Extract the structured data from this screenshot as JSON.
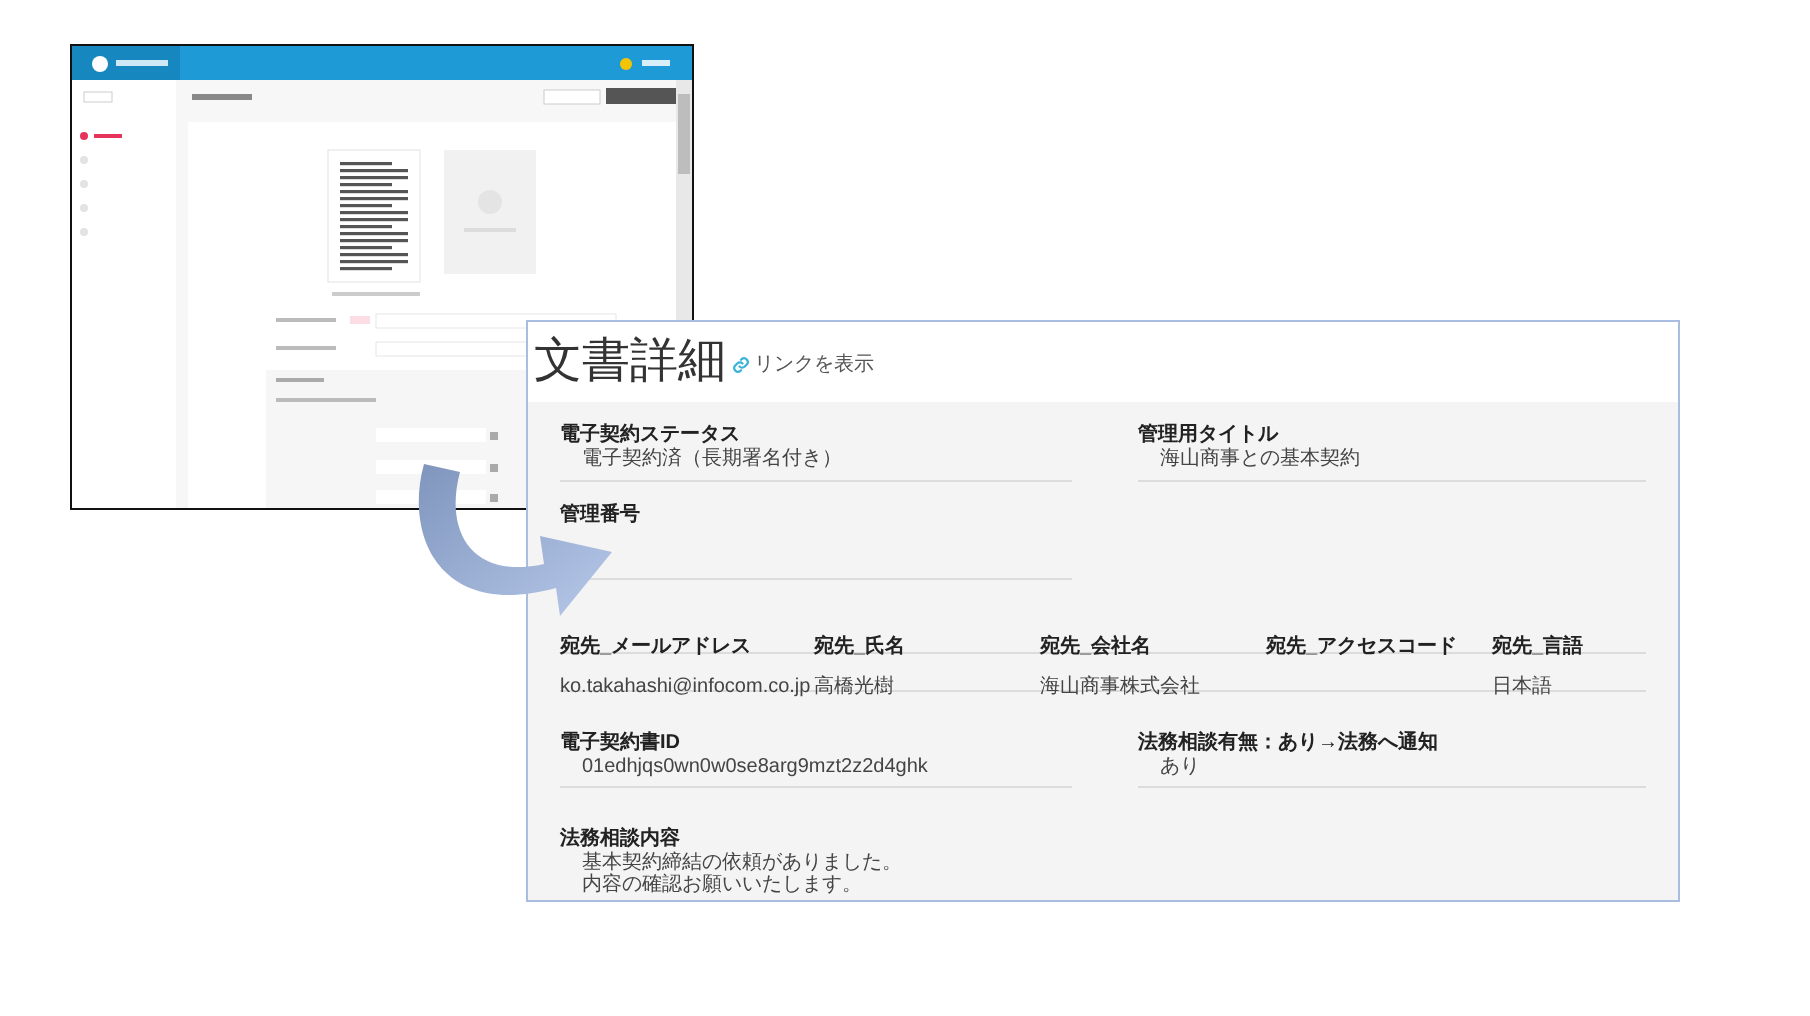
{
  "document_detail": {
    "title": "文書詳細",
    "link": "リンクを表示",
    "top_fields": [
      {
        "label": "電子契約ステータス",
        "value": "電子契約済（長期署名付き）"
      },
      {
        "label": "管理用タイトル",
        "value": "海山商事との基本契約"
      }
    ],
    "management_number": {
      "label": "管理番号"
    },
    "recipient_columns": [
      {
        "label": "宛先_メールアドレス",
        "value": "ko.takahashi@infocom.co.jp"
      },
      {
        "label": "宛先_氏名",
        "value": "高橋光樹"
      },
      {
        "label": "宛先_会社名",
        "value": "海山商事株式会社"
      },
      {
        "label": "宛先_アクセスコード"
      },
      {
        "label": "宛先_言語",
        "value": "日本語"
      }
    ],
    "bottom_fields": [
      {
        "label": "電子契約書ID",
        "value": "01edhjqs0wn0w0se8arg9mzt2z2d4ghk"
      },
      {
        "label": "法務相談有無：あり→法務へ通知",
        "value": "あり"
      }
    ],
    "consultation": {
      "label": "法務相談内容",
      "lines": [
        "基本契約締結の依頼がありました。",
        "内容の確認お願いいたします。"
      ]
    }
  }
}
